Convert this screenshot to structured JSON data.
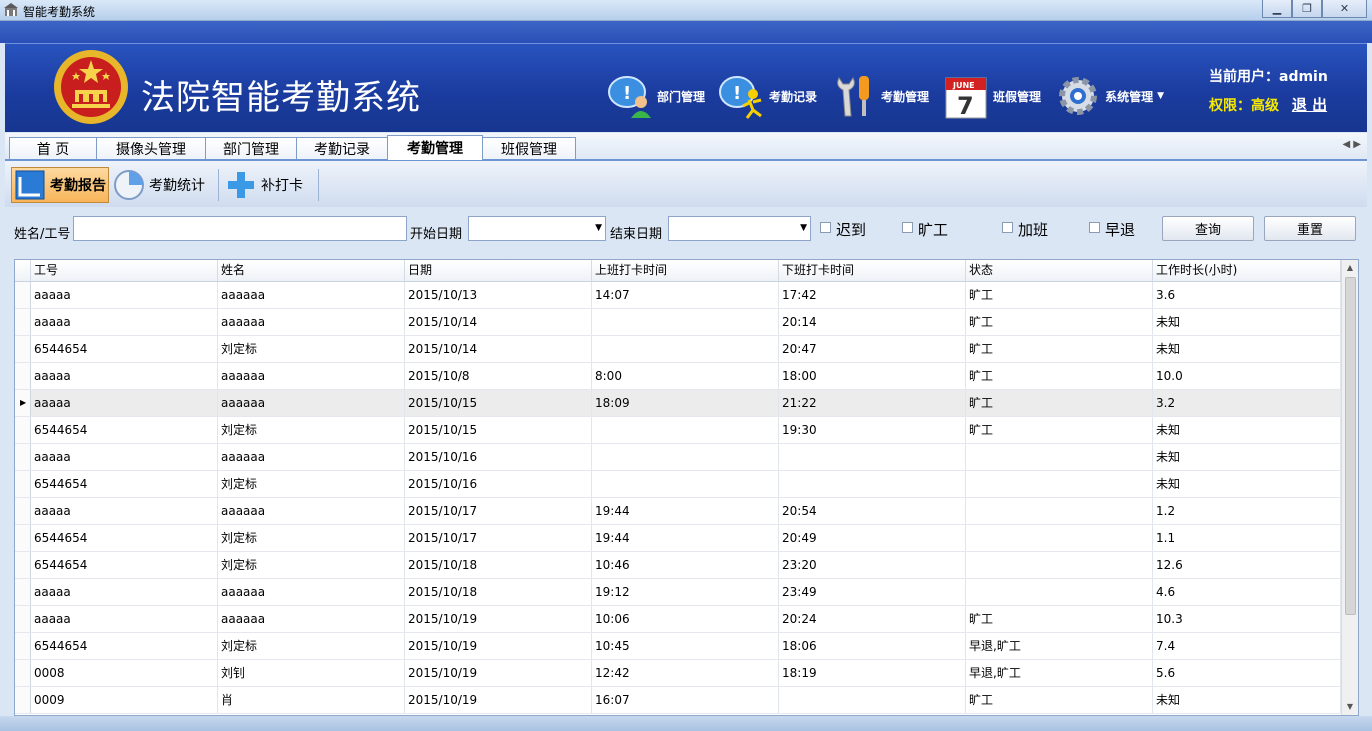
{
  "window": {
    "title": "智能考勤系统",
    "controls": [
      "minimize",
      "restore",
      "close"
    ]
  },
  "header": {
    "app_title": "法院智能考勤系统",
    "nav": [
      {
        "label": "部门管理",
        "icon": "chat-person-icon"
      },
      {
        "label": "考勤记录",
        "icon": "running-person-icon"
      },
      {
        "label": "考勤管理",
        "icon": "tools-icon"
      },
      {
        "label": "班假管理",
        "icon": "calendar-icon",
        "calendar_month": "JUNE",
        "calendar_day": "7"
      },
      {
        "label": "系统管理",
        "icon": "gear-icon"
      }
    ],
    "user_label": "当前用户：",
    "user_name": "admin",
    "perm_label": "权限：",
    "perm_value": "高级",
    "logout": "退 出"
  },
  "tabs": [
    {
      "label": "首 页"
    },
    {
      "label": "摄像头管理"
    },
    {
      "label": "部门管理"
    },
    {
      "label": "考勤记录"
    },
    {
      "label": "考勤管理",
      "active": true
    },
    {
      "label": "班假管理"
    }
  ],
  "subtoolbar": [
    {
      "label": "考勤报告",
      "active": true,
      "icon": "report-icon"
    },
    {
      "label": "考勤统计",
      "icon": "pie-chart-icon"
    },
    {
      "label": "补打卡",
      "icon": "plus-icon"
    }
  ],
  "filter": {
    "name_label": "姓名/工号",
    "name_value": "",
    "start_label": "开始日期",
    "start_value": "",
    "end_label": "结束日期",
    "end_value": "",
    "checkboxes": [
      {
        "label": "迟到",
        "checked": false
      },
      {
        "label": "旷工",
        "checked": false
      },
      {
        "label": "加班",
        "checked": false
      },
      {
        "label": "早退",
        "checked": false
      }
    ],
    "query_button": "查询",
    "reset_button": "重置"
  },
  "table": {
    "columns": [
      "工号",
      "姓名",
      "日期",
      "上班打卡时间",
      "下班打卡时间",
      "状态",
      "工作时长(小时)"
    ],
    "selected_row": 4,
    "rows": [
      [
        "aaaaa",
        "aaaaaa",
        "2015/10/13",
        "14:07",
        "17:42",
        "旷工",
        "3.6"
      ],
      [
        "aaaaa",
        "aaaaaa",
        "2015/10/14",
        "",
        "20:14",
        "旷工",
        "未知"
      ],
      [
        "6544654",
        "刘定标",
        "2015/10/14",
        "",
        "20:47",
        "旷工",
        "未知"
      ],
      [
        "aaaaa",
        "aaaaaa",
        "2015/10/8",
        "8:00",
        "18:00",
        "旷工",
        "10.0"
      ],
      [
        "aaaaa",
        "aaaaaa",
        "2015/10/15",
        "18:09",
        "21:22",
        "旷工",
        "3.2"
      ],
      [
        "6544654",
        "刘定标",
        "2015/10/15",
        "",
        "19:30",
        "旷工",
        "未知"
      ],
      [
        "aaaaa",
        "aaaaaa",
        "2015/10/16",
        "",
        "",
        "",
        "未知"
      ],
      [
        "6544654",
        "刘定标",
        "2015/10/16",
        "",
        "",
        "",
        "未知"
      ],
      [
        "aaaaa",
        "aaaaaa",
        "2015/10/17",
        "19:44",
        "20:54",
        "",
        "1.2"
      ],
      [
        "6544654",
        "刘定标",
        "2015/10/17",
        "19:44",
        "20:49",
        "",
        "1.1"
      ],
      [
        "6544654",
        "刘定标",
        "2015/10/18",
        "10:46",
        "23:20",
        "",
        "12.6"
      ],
      [
        "aaaaa",
        "aaaaaa",
        "2015/10/18",
        "19:12",
        "23:49",
        "",
        "4.6"
      ],
      [
        "aaaaa",
        "aaaaaa",
        "2015/10/19",
        "10:06",
        "20:24",
        "旷工",
        "10.3"
      ],
      [
        "6544654",
        "刘定标",
        "2015/10/19",
        "10:45",
        "18:06",
        "早退,旷工",
        "7.4"
      ],
      [
        "0008",
        "刘钊",
        "2015/10/19",
        "12:42",
        "18:19",
        "早退,旷工",
        "5.6"
      ],
      [
        "0009",
        "肖",
        "2015/10/19",
        "16:07",
        "",
        "旷工",
        "未知"
      ]
    ]
  }
}
